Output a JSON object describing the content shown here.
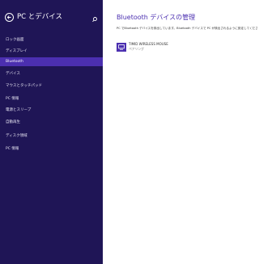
{
  "sidebar": {
    "title": "PC とデバイス",
    "items": [
      {
        "label": "ロック画面",
        "selected": false
      },
      {
        "label": "ディスプレイ",
        "selected": false
      },
      {
        "label": "Bluetooth",
        "selected": true
      },
      {
        "label": "デバイス",
        "selected": false
      },
      {
        "label": "マウスとタッチパッド",
        "selected": false
      },
      {
        "label": "PC 情報",
        "selected": false
      },
      {
        "label": "電源とスリープ",
        "selected": false
      },
      {
        "label": "自動再生",
        "selected": false
      },
      {
        "label": "ディスク領域",
        "selected": false
      },
      {
        "label": "PC 情報",
        "selected": false
      }
    ]
  },
  "main": {
    "title": "Bluetooth デバイスの管理",
    "description": "PC でBluetooth デバイスを検出しています。Bluetooth デバイスで PC が検出されるように設定してください。",
    "devices": [
      {
        "name": "TIMID WIRELESS MOUSE",
        "status": "ペアリング"
      }
    ]
  },
  "colors": {
    "sidebar_bg": "#1f1556",
    "accent": "#4b2fb0"
  },
  "icons": {
    "back": "back-arrow-icon",
    "search": "search-icon",
    "device": "device-icon"
  }
}
